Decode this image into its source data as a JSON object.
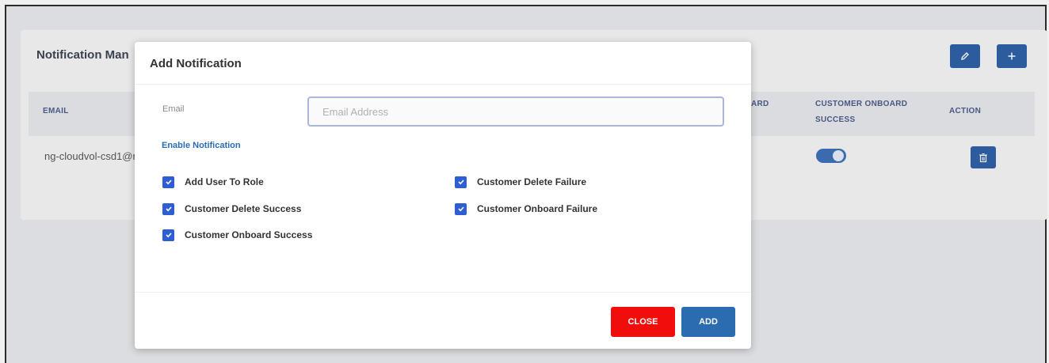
{
  "page": {
    "title": "Notification Man"
  },
  "header_buttons": {
    "edit_icon": "pencil-icon",
    "add_icon": "plus-icon"
  },
  "table": {
    "columns": {
      "email": "EMAIL",
      "partial": "ARD",
      "customer_onboard_success": "CUSTOMER ONBOARD SUCCESS",
      "action": "ACTION"
    },
    "rows": [
      {
        "email": "ng-cloudvol-csd1@r",
        "customer_onboard_success": true
      }
    ]
  },
  "modal": {
    "title": "Add Notification",
    "email_label": "Email",
    "email_placeholder": "Email Address",
    "email_value": "",
    "section_label": "Enable Notification",
    "options": [
      {
        "label": "Add User To Role",
        "checked": true
      },
      {
        "label": "Customer Delete Failure",
        "checked": true
      },
      {
        "label": "Customer Delete Success",
        "checked": true
      },
      {
        "label": "Customer Onboard Failure",
        "checked": true
      },
      {
        "label": "Customer Onboard Success",
        "checked": true
      }
    ],
    "close_label": "CLOSE",
    "add_label": "ADD"
  },
  "colors": {
    "primary": "#2b5ea7",
    "danger": "#f20d0d",
    "checkbox": "#2f5ed2",
    "link": "#2b6cb0"
  }
}
